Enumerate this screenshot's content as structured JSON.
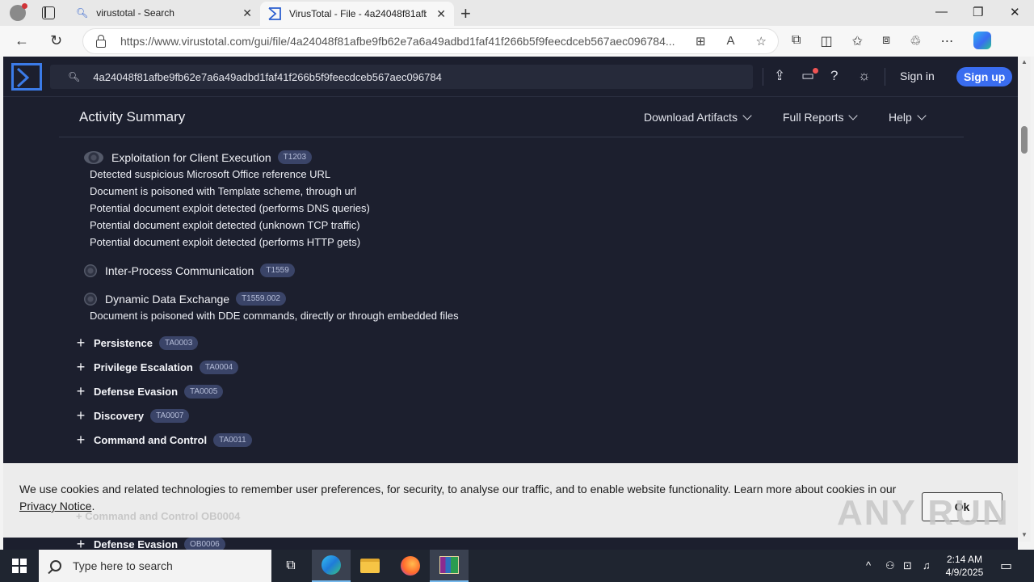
{
  "browser": {
    "tabs": [
      {
        "title": "virustotal - Search",
        "active": false
      },
      {
        "title": "VirusTotal - File - 4a24048f81afbe",
        "active": true
      }
    ],
    "url": "https://www.virustotal.com/gui/file/4a24048f81afbe9fb62e7a6a49adbd1faf41f266b5f9feecdceb567aec096784..."
  },
  "vt": {
    "search_value": "4a24048f81afbe9fb62e7a6a49adbd1faf41f266b5f9feecdceb567aec096784",
    "sign_in": "Sign in",
    "sign_up": "Sign up"
  },
  "activity": {
    "title": "Activity Summary",
    "menus": [
      "Download Artifacts",
      "Full Reports",
      "Help"
    ],
    "techniques": [
      {
        "name": "Exploitation for Client Execution",
        "id": "T1203"
      },
      {
        "name": "Inter-Process Communication",
        "id": "T1559"
      },
      {
        "name": "Dynamic Data Exchange",
        "id": "T1559.002"
      }
    ],
    "exploitation_details": [
      "Detected suspicious Microsoft Office reference URL",
      "Document is poisoned with Template scheme, through url",
      "Potential document exploit detected (performs DNS queries)",
      "Potential document exploit detected (unknown TCP traffic)",
      "Potential document exploit detected (performs HTTP gets)"
    ],
    "dde_detail": "Document is poisoned with DDE commands, directly or through embedded files",
    "tactics": [
      {
        "name": "Persistence",
        "id": "TA0003"
      },
      {
        "name": "Privilege Escalation",
        "id": "TA0004"
      },
      {
        "name": "Defense Evasion",
        "id": "TA0005"
      },
      {
        "name": "Discovery",
        "id": "TA0007"
      },
      {
        "name": "Command and Control",
        "id": "TA0011"
      }
    ],
    "below_banner": [
      {
        "name": "Command and Control",
        "id": "OB0004"
      },
      {
        "name": "Defense Evasion",
        "id": "OB0006"
      }
    ]
  },
  "cookie": {
    "text": "We use cookies and related technologies to remember user preferences, for security, to analyse our traffic, and to enable website functionality. Learn more about cookies in our ",
    "link": "Privacy Notice",
    "end": ".",
    "ok": "Ok"
  },
  "watermark": "ANY RUN",
  "taskbar": {
    "search_placeholder": "Type here to search",
    "time": "2:14 AM",
    "date": "4/9/2025"
  }
}
